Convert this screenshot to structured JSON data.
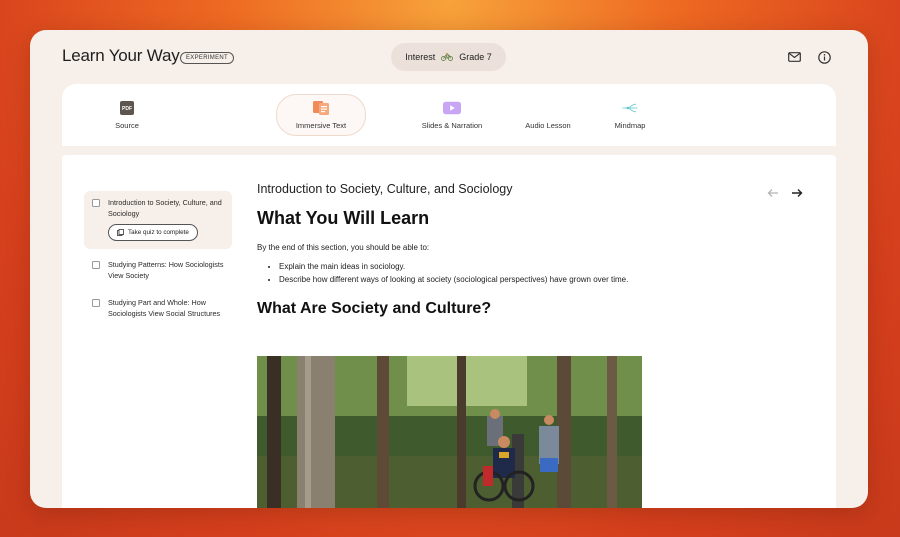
{
  "app": {
    "brand": "Learn Your Way",
    "badge": "EXPERIMENT",
    "interest_label": "Interest",
    "grade_label": "Grade 7"
  },
  "header_icons": [
    "mail-icon",
    "info-icon"
  ],
  "modes": [
    {
      "id": "source",
      "label": "Source",
      "icon": "pdf-icon",
      "active": false
    },
    {
      "id": "immersive-text",
      "label": "Immersive Text",
      "icon": "immersive-text-icon",
      "active": true
    },
    {
      "id": "slides-narration",
      "label": "Slides & Narration",
      "icon": "slides-icon",
      "active": false
    },
    {
      "id": "audio-lesson",
      "label": "Audio Lesson",
      "icon": "audio-icon",
      "active": false
    },
    {
      "id": "mindmap",
      "label": "Mindmap",
      "icon": "mindmap-icon",
      "active": false
    }
  ],
  "pdf_icon_text": "PDF",
  "toc": {
    "items": [
      {
        "label": "Introduction to Society, Culture, and Sociology",
        "active": true
      },
      {
        "label": "Studying Patterns: How Sociologists View Society",
        "active": false
      },
      {
        "label": "Studying Part and Whole: How Sociologists View Social Structures",
        "active": false
      }
    ],
    "quiz_button": "Take quiz to complete"
  },
  "article": {
    "section_title": "Introduction to Society, Culture, and Sociology",
    "heading1": "What You Will Learn",
    "intro": "By the end of this section, you should be able to:",
    "bullets": [
      "Explain the main ideas in sociology.",
      "Describe how different ways of looking at society (sociological perspectives) have grown over time."
    ],
    "heading2": "What Are Society and Culture?"
  },
  "colors": {
    "accent_orange": "#ee6a22",
    "window_bg": "#f7efe9",
    "slides_purple": "#b58cf0",
    "mindmap_teal": "#5cc4c9"
  }
}
